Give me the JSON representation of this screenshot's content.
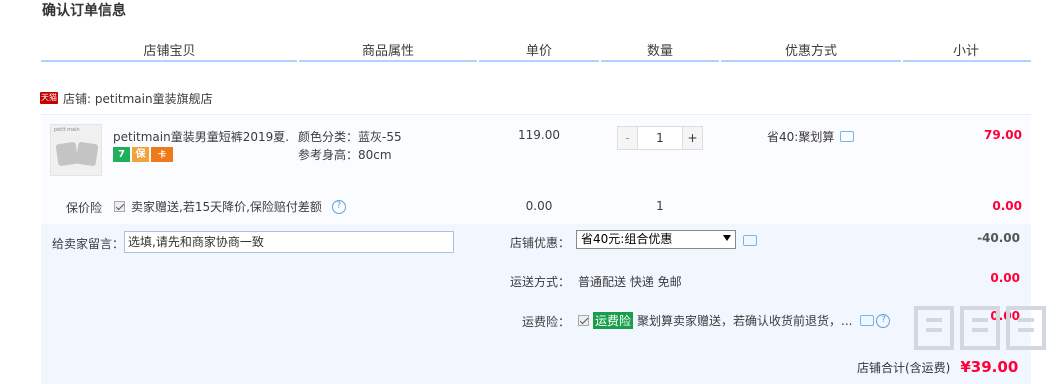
{
  "title": "确认订单信息",
  "headers": [
    "店铺宝贝",
    "商品属性",
    "单价",
    "数量",
    "优惠方式",
    "小计"
  ],
  "shop": {
    "badge": "天猫",
    "label": "店铺: petitmain童装旗舰店"
  },
  "item": {
    "name": "petitmain童装男童短裤2019夏...",
    "badges": [
      "7",
      "保",
      "卡"
    ],
    "attr_color": "颜色分类：蓝灰-55",
    "attr_height": "参考身高：80cm",
    "price": "119.00",
    "qty_minus": "-",
    "qty": "1",
    "qty_plus": "+",
    "discount": "省40:聚划算",
    "subtotal": "79.00",
    "thumb_brand": "petit main"
  },
  "insurance": {
    "label": "保价险",
    "text": "卖家赠送,若15天降价,保险赔付差额",
    "price": "0.00",
    "qty": "1",
    "subtotal": "0.00"
  },
  "message": {
    "label": "给卖家留言：",
    "placeholder": "选填,请先和商家协商一致"
  },
  "shop_discount": {
    "label": "店铺优惠：",
    "selected": "省40元:组合优惠",
    "value": "-40.00"
  },
  "shipping": {
    "label": "运送方式：",
    "text": "普通配送 快递 免邮",
    "value": "0.00"
  },
  "freight_ins": {
    "label": "运费险：",
    "tag": "运费险",
    "text": "聚划算卖家赠送，若确认收货前退货，...",
    "value": "0.00"
  },
  "total": {
    "label": "店铺合计(含运费)",
    "value": "¥39.00"
  },
  "watermark": "值值值",
  "colors": {
    "accent_red": "#ff0036",
    "header_line": "#b2d1ff",
    "block_bg": "#f2f7ff"
  }
}
